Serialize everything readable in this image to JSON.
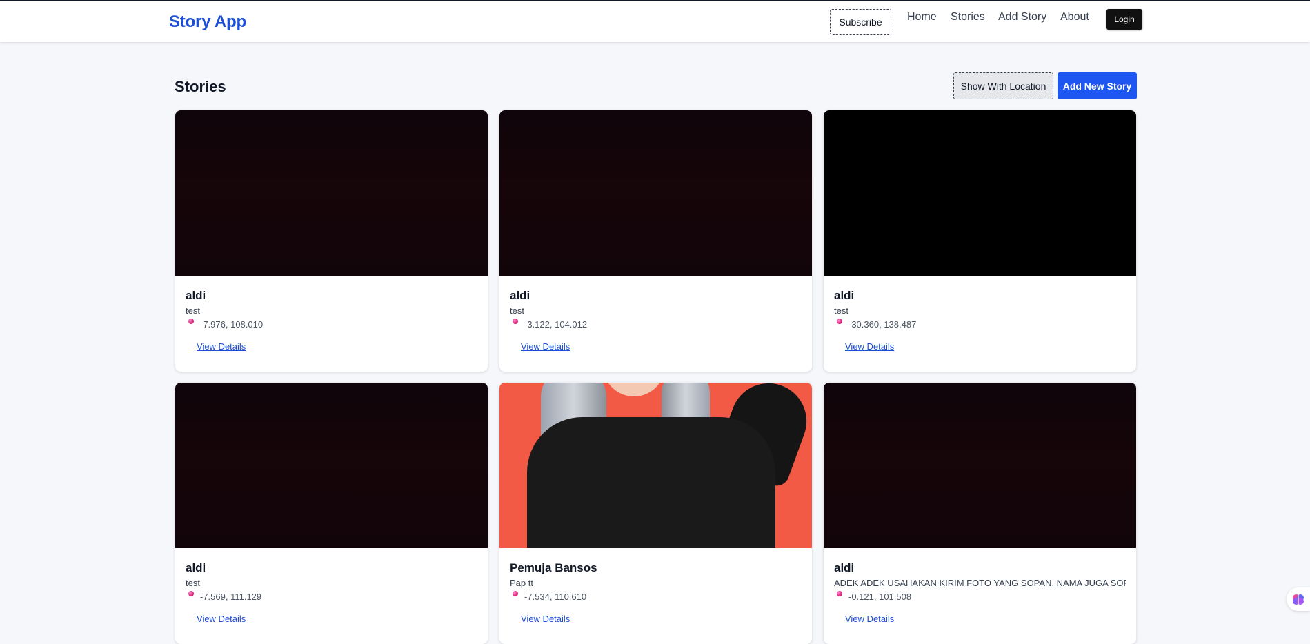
{
  "nav": {
    "brand": "Story App",
    "subscribe": "Subscribe",
    "links": [
      "Home",
      "Stories",
      "Add Story",
      "About"
    ],
    "login": "Login"
  },
  "page": {
    "title": "Stories",
    "show_location": "Show With Location",
    "add_new": "Add New Story"
  },
  "stories": [
    {
      "name": "aldi",
      "description": "test",
      "location": "-7.976, 108.010",
      "link": "View Details",
      "image": "dark"
    },
    {
      "name": "aldi",
      "description": "test",
      "location": "-3.122, 104.012",
      "link": "View Details",
      "image": "dark"
    },
    {
      "name": "aldi",
      "description": "test",
      "location": "-30.360, 138.487",
      "link": "View Details",
      "image": "black"
    },
    {
      "name": "aldi",
      "description": "test",
      "location": "-7.569, 111.129",
      "link": "View Details",
      "image": "dark"
    },
    {
      "name": "Pemuja Bansos",
      "description": "Pap tt",
      "location": "-7.534, 110.610",
      "link": "View Details",
      "image": "portrait"
    },
    {
      "name": "aldi",
      "description": "ADEK ADEK USAHAKAN KIRIM FOTO YANG SOPAN, NAMA JUGA SOPAN",
      "location": "-0.121, 101.508",
      "link": "View Details",
      "image": "dark"
    }
  ],
  "colors": {
    "brand": "#1d4ed8",
    "primary_button": "#1d56f0",
    "pin": "#db2777"
  },
  "icons": {
    "location": "map-pin-icon",
    "floating": "brain-icon"
  }
}
